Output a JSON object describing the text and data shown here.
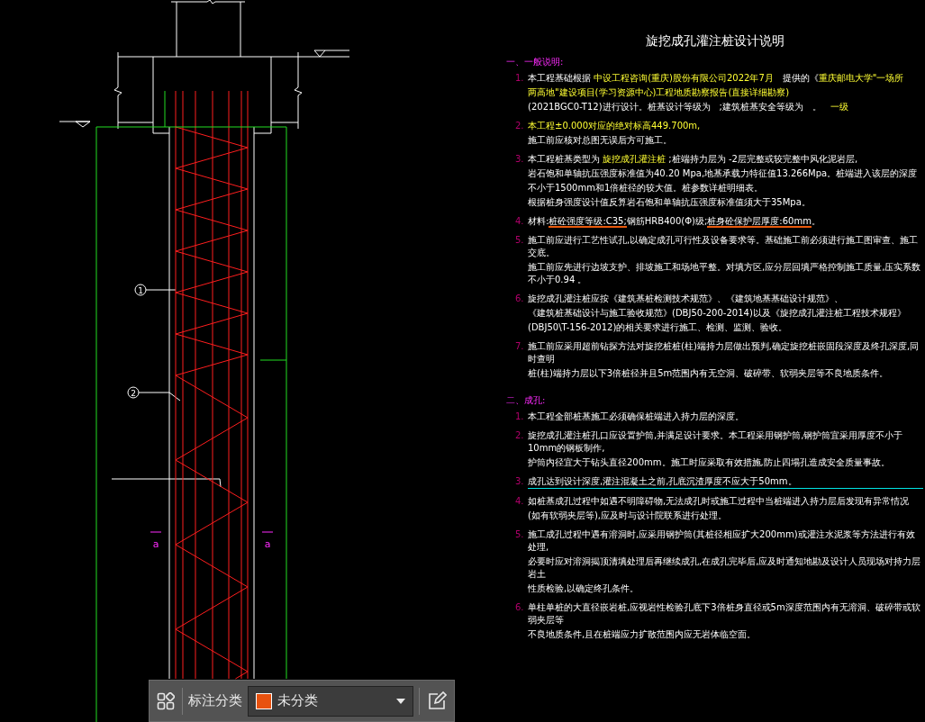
{
  "drawing": {
    "callouts": [
      {
        "text": "1"
      },
      {
        "text": "2"
      }
    ],
    "section_marks": [
      {
        "text": "a"
      },
      {
        "text": "a"
      }
    ]
  },
  "notes": {
    "title": "旋挖成孔灌注桩设计说明",
    "sections": [
      {
        "heading": "一、一般说明:",
        "items": [
          {
            "number": "1.",
            "underlined": false,
            "lines": [
              [
                {
                  "text": "本工程基础根据 ",
                  "kind": "plain"
                },
                {
                  "text": "中设工程咨询(重庆)股份有限公司2022年7月",
                  "kind": "highlight"
                },
                {
                  "text": "　提供的《",
                  "kind": "plain"
                },
                {
                  "text": "重庆邮电大学\"一场所",
                  "kind": "highlight"
                }
              ],
              [
                {
                  "text": "两高地\"建设项目(学习资源中心)工程地质勘察报告(直接详细勘察)",
                  "kind": "highlight"
                }
              ],
              [
                {
                  "text": "(2021BGC0-T12)进行设计。桩基设计等级为　;建筑桩基安全等级为　。　",
                  "kind": "plain"
                },
                {
                  "text": "一级",
                  "kind": "highlight"
                }
              ]
            ]
          },
          {
            "number": "2.",
            "underlined": false,
            "lines": [
              [
                {
                  "text": "本工程±0.000对应的绝对标高449.700m,",
                  "kind": "highlight"
                }
              ],
              [
                {
                  "text": "施工前应核对总图无误后方可施工。",
                  "kind": "plain"
                }
              ]
            ]
          },
          {
            "number": "3.",
            "underlined": false,
            "lines": [
              [
                {
                  "text": "本工程桩基类型为 ",
                  "kind": "plain"
                },
                {
                  "text": "旋挖成孔灌注桩",
                  "kind": "highlight"
                },
                {
                  "text": " ;桩端持力层为 -2层完整或较完整中风化泥岩层,",
                  "kind": "plain"
                }
              ],
              [
                {
                  "text": "岩石饱和单轴抗压强度标准值为40.20 Mpa,地基承载力特征值13.266Mpa。桩端进入该层的深度",
                  "kind": "plain"
                }
              ],
              [
                {
                  "text": "不小于1500mm和1倍桩径的较大值。桩参数详桩明细表。",
                  "kind": "plain"
                }
              ],
              [
                {
                  "text": "根据桩身强度设计值反算岩石饱和单轴抗压强度标准值须大于35Mpa。",
                  "kind": "plain"
                }
              ]
            ]
          },
          {
            "number": "4.",
            "underlined": false,
            "lines": [
              [
                {
                  "text": "材料:",
                  "kind": "plain"
                },
                {
                  "text": "桩砼强度等级:C35;",
                  "kind": "marked"
                },
                {
                  "text": "钢筋HRB400(Φ)级;",
                  "kind": "plain"
                },
                {
                  "text": "桩身砼保护层厚度:60mm",
                  "kind": "marked"
                },
                {
                  "text": "。",
                  "kind": "plain"
                }
              ]
            ]
          },
          {
            "number": "5.",
            "underlined": false,
            "lines": [
              [
                {
                  "text": "施工前应进行工艺性试孔,以确定成孔可行性及设备要求等。基础施工前必须进行施工图审查、施工交底。",
                  "kind": "plain"
                }
              ],
              [
                {
                  "text": "施工前应先进行边坡支护、排坡施工和场地平整。对填方区,应分层回填严格控制施工质量,压实系数不小于0.94 。",
                  "kind": "plain"
                }
              ]
            ]
          },
          {
            "number": "6.",
            "underlined": false,
            "lines": [
              [
                {
                  "text": "旋挖成孔灌注桩应按《建筑基桩检测技术规范》、《建筑地基基础设计规范》、",
                  "kind": "plain"
                }
              ],
              [
                {
                  "text": "《建筑桩基础设计与施工验收规范》(DBJ50-200-2014)以及《旋挖成孔灌注桩工程技术规程》",
                  "kind": "plain"
                }
              ],
              [
                {
                  "text": "(DBJ50\\T-156-2012)的相关要求进行施工、检测、监测、验收。",
                  "kind": "plain"
                }
              ]
            ]
          },
          {
            "number": "7.",
            "underlined": false,
            "lines": [
              [
                {
                  "text": "施工前应采用超前钻探方法对旋挖桩桩(柱)端持力层做出预判,确定旋挖桩嵌固段深度及终孔深度,同时查明",
                  "kind": "plain"
                }
              ],
              [
                {
                  "text": "桩(柱)端持力层以下3倍桩径并且5m范围内有无空洞、破碎带、软弱夹层等不良地质条件。",
                  "kind": "plain"
                }
              ]
            ]
          }
        ]
      },
      {
        "heading": "二、成孔:",
        "items": [
          {
            "number": "1.",
            "underlined": false,
            "lines": [
              [
                {
                  "text": "本工程全部桩基施工必须确保桩端进入持力层的深度。",
                  "kind": "plain"
                }
              ]
            ]
          },
          {
            "number": "2.",
            "underlined": false,
            "lines": [
              [
                {
                  "text": "旋挖成孔灌注桩孔口应设置护筒,并满足设计要求。本工程采用钢护筒,钢护筒宜采用厚度不小于10mm的钢板制作,",
                  "kind": "plain"
                }
              ],
              [
                {
                  "text": "护筒内径宜大于钻头直径200mm。施工时应采取有效措施,防止四塌孔造成安全质量事故。",
                  "kind": "plain"
                }
              ]
            ]
          },
          {
            "number": "3.",
            "underlined": true,
            "lines": [
              [
                {
                  "text": "成孔达到设计深度,灌注混凝土之前,孔底沉渣厚度不应大于50mm。",
                  "kind": "plain"
                }
              ]
            ]
          },
          {
            "number": "4.",
            "underlined": false,
            "lines": [
              [
                {
                  "text": "如桩基成孔过程中如遇不明障碍物,无法成孔时或施工过程中当桩端进入持力层后发现有异常情况",
                  "kind": "plain"
                }
              ],
              [
                {
                  "text": "(如有软弱夹层等),应及时与设计院联系进行处理。",
                  "kind": "plain"
                }
              ]
            ]
          },
          {
            "number": "5.",
            "underlined": false,
            "lines": [
              [
                {
                  "text": "施工成孔过程中遇有溶洞时,应采用钢护筒(其桩径相应扩大200mm)或灌注水泥浆等方法进行有效处理,",
                  "kind": "plain"
                }
              ],
              [
                {
                  "text": "必要时应对溶洞揭顶清填处理后再继续成孔,在成孔完毕后,应及时通知地勘及设计人员现场对持力层岩土",
                  "kind": "plain"
                }
              ],
              [
                {
                  "text": "性质检验,以确定终孔条件。",
                  "kind": "plain"
                }
              ]
            ]
          },
          {
            "number": "6.",
            "underlined": false,
            "lines": [
              [
                {
                  "text": "单柱单桩的大直径嵌岩桩,应视岩性检验孔底下3倍桩身直径或5m深度范围内有无溶洞、破碎带或软弱夹层等",
                  "kind": "plain"
                }
              ],
              [
                {
                  "text": "不良地质条件,且在桩端应力扩散范围内应无岩体临空面。",
                  "kind": "plain"
                }
              ]
            ]
          }
        ]
      }
    ]
  },
  "toolbar": {
    "label": "标注分类",
    "category": {
      "value": "未分类",
      "color": "#e8520f"
    }
  }
}
